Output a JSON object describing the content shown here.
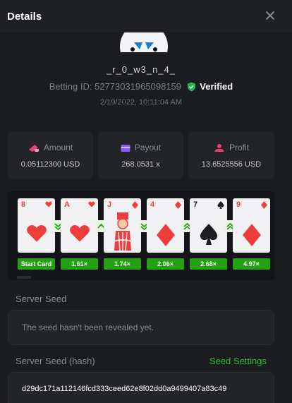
{
  "header": {
    "title": "Details"
  },
  "user": {
    "username": "_r_0_w3_n_4_",
    "betting_id_label": "Betting ID:",
    "betting_id": "52773031965098159",
    "verified_label": "Verified",
    "timestamp": "2/19/2022, 10:11:04 AM"
  },
  "stats": [
    {
      "label": "Amount",
      "value": "0.05112300 USD",
      "icon": "cash-icon",
      "color": "#e8436e"
    },
    {
      "label": "Payout",
      "value": "268.0531 x",
      "icon": "wallet-icon",
      "color": "#8b5cf6"
    },
    {
      "label": "Profit",
      "value": "13.6525556 USD",
      "icon": "profit-icon",
      "color": "#e8436e"
    }
  ],
  "cards": [
    {
      "rank": "8",
      "suit": "hearts",
      "multiplier": "Start Card"
    },
    {
      "rank": "A",
      "suit": "hearts",
      "multiplier": "1.61×",
      "arrow": "down"
    },
    {
      "rank": "J",
      "suit": "diamonds",
      "multiplier": "1.74×",
      "arrow": "up"
    },
    {
      "rank": "4",
      "suit": "diamonds",
      "multiplier": "2.06×",
      "arrow": "down"
    },
    {
      "rank": "7",
      "suit": "spades",
      "multiplier": "2.68×",
      "arrow": "up"
    },
    {
      "rank": "9",
      "suit": "diamonds",
      "multiplier": "4.97×",
      "arrow": "up"
    }
  ],
  "server_seed": {
    "label": "Server Seed",
    "value": "The seed hasn't been revealed yet."
  },
  "server_seed_hash": {
    "label": "Server Seed (hash)",
    "link_label": "Seed Settings",
    "value": "d29dc171a112146fcd333ceed62e8f02dd0a9499407a83c49"
  },
  "colors": {
    "accent_green": "#24a112",
    "link_green": "#2fbf2f",
    "card_red": "#ee3d3d",
    "card_black": "#1d1d22"
  }
}
